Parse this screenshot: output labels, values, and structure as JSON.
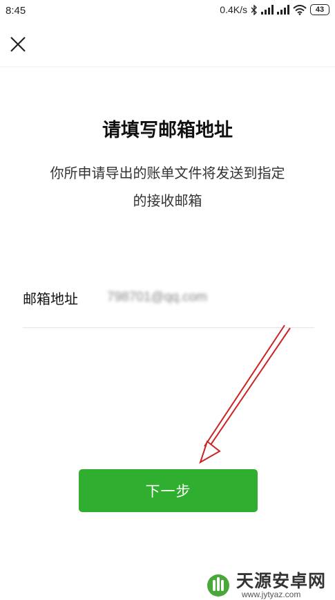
{
  "status_bar": {
    "time": "8:45",
    "net_speed": "0.4K/s",
    "battery": "43",
    "icons": [
      "bluetooth-icon",
      "signal-icon",
      "signal-icon",
      "wifi-icon",
      "battery-icon"
    ]
  },
  "header": {
    "close_icon": "close-icon"
  },
  "page": {
    "title": "请填写邮箱地址",
    "subtitle_line1": "你所申请导出的账单文件将发送到指定",
    "subtitle_line2": "的接收邮箱"
  },
  "form": {
    "email_label": "邮箱地址",
    "email_value": "798701@qq.com"
  },
  "actions": {
    "next_label": "下一步"
  },
  "annotation": {
    "arrow_color": "#cc2222"
  },
  "watermark": {
    "name": "天源安卓网",
    "url": "www.jytyaz.com"
  },
  "colors": {
    "primary_button": "#2fae2f",
    "text": "#1a1a1a",
    "divider": "#e4e4e4"
  }
}
